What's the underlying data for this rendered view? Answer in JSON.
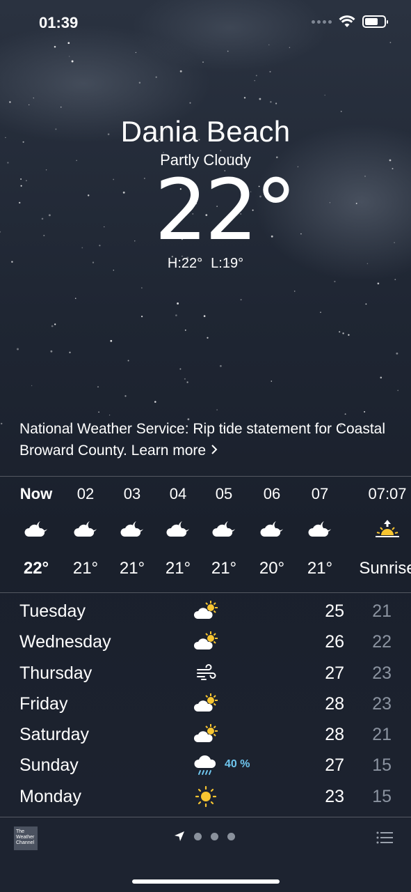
{
  "status_bar": {
    "time": "01:39",
    "battery_level": 0.7
  },
  "location": {
    "city": "Dania Beach",
    "condition": "Partly Cloudy",
    "temperature": "22°",
    "high": "H:22°",
    "low": "L:19°"
  },
  "alert": {
    "text": "National Weather Service: Rip tide statement for Coastal Broward County. Learn more",
    "chevron": "›"
  },
  "hourly": [
    {
      "label": "Now",
      "icon": "partly-cloudy-night-icon",
      "temp": "22°",
      "bold": true
    },
    {
      "label": "02",
      "icon": "partly-cloudy-night-icon",
      "temp": "21°"
    },
    {
      "label": "03",
      "icon": "partly-cloudy-night-icon",
      "temp": "21°"
    },
    {
      "label": "04",
      "icon": "partly-cloudy-night-icon",
      "temp": "21°"
    },
    {
      "label": "05",
      "icon": "partly-cloudy-night-icon",
      "temp": "21°"
    },
    {
      "label": "06",
      "icon": "partly-cloudy-night-icon",
      "temp": "20°"
    },
    {
      "label": "07",
      "icon": "partly-cloudy-night-icon",
      "temp": "21°"
    },
    {
      "label": "07:07",
      "icon": "sunrise-icon",
      "temp": "Sunrise"
    }
  ],
  "daily": [
    {
      "day": "Tuesday",
      "icon": "partly-sunny-icon",
      "precip": "",
      "high": "25",
      "low": "21"
    },
    {
      "day": "Wednesday",
      "icon": "partly-sunny-icon",
      "precip": "",
      "high": "26",
      "low": "22"
    },
    {
      "day": "Thursday",
      "icon": "windy-icon",
      "precip": "",
      "high": "27",
      "low": "23"
    },
    {
      "day": "Friday",
      "icon": "partly-sunny-icon",
      "precip": "",
      "high": "28",
      "low": "23"
    },
    {
      "day": "Saturday",
      "icon": "partly-sunny-icon",
      "precip": "",
      "high": "28",
      "low": "21"
    },
    {
      "day": "Sunday",
      "icon": "rain-icon",
      "precip": "40 %",
      "high": "27",
      "low": "15"
    },
    {
      "day": "Monday",
      "icon": "sunny-icon",
      "precip": "",
      "high": "23",
      "low": "15"
    }
  ],
  "bottom_bar": {
    "logo_text": "The Weather Channel",
    "pages": 3,
    "colors": {
      "precip": "#6fc6ee",
      "sun": "#f7c531"
    }
  }
}
